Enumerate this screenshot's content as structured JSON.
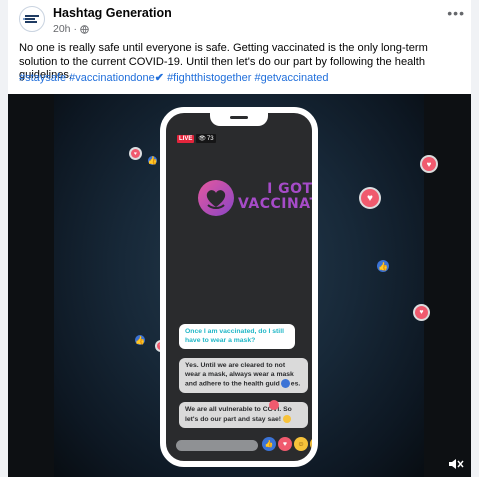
{
  "post": {
    "page_name": "Hashtag Generation",
    "time": "20h",
    "body": "No one is really safe until everyone is safe. Getting vaccinated is the only long-term solution to the current COVID-19. Until then let's do our part by following the health guidelines.",
    "hashtags": [
      "#staysafe",
      "#vaccinationdone",
      "#fightthistogether",
      "#getvaccinated"
    ],
    "check_glyph": "✔"
  },
  "video": {
    "live_label": "LIVE",
    "viewer_count": "73",
    "logo_line1": "I GOT",
    "logo_line2": "VACCINATED",
    "question": "Once I am vaccinated, do I still have to wear a mask?",
    "answer1_a": "Yes. Until we are cleared to not wear a mask,  always wear a mask and adhere to the health guid",
    "answer1_b": "es.",
    "answer2_a": "We are all vulnerable to COVI",
    "answer2_b": ". So let's do our part and stay sa",
    "answer2_c": "e!"
  },
  "colors": {
    "hashtag": "#216fdb",
    "live": "#e4253c",
    "logo": "#a64bc8",
    "question_text": "#21b7c7"
  }
}
